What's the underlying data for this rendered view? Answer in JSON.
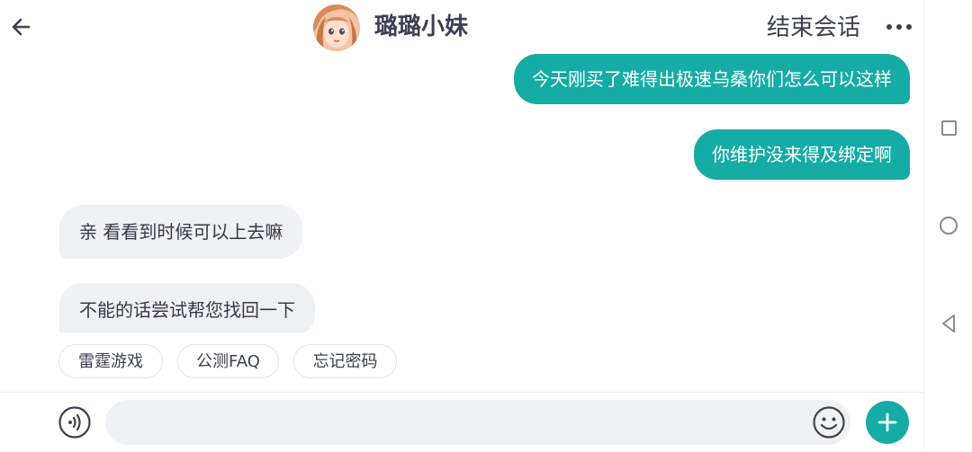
{
  "header": {
    "title": "璐璐小妹",
    "end_chat_label": "结束会话"
  },
  "messages": [
    {
      "side": "right",
      "text": "今天刚买了难得出极速乌桑你们怎么可以这样"
    },
    {
      "side": "right",
      "text": "你维护没来得及绑定啊"
    },
    {
      "side": "left",
      "text": "亲 看看到时候可以上去嘛"
    },
    {
      "side": "left",
      "text": "不能的话尝试帮您找回一下"
    }
  ],
  "quick_replies": [
    "雷霆游戏",
    "公测FAQ",
    "忘记密码"
  ],
  "input": {
    "value": "",
    "placeholder": ""
  },
  "colors": {
    "accent": "#16aca6",
    "incoming_bubble": "#eff1f5",
    "text_dark": "#3a4150"
  },
  "icons": {
    "back": "arrow-left-icon",
    "more": "more-dots-icon",
    "voice": "voice-icon",
    "emoji": "smiley-icon",
    "plus": "plus-icon"
  }
}
